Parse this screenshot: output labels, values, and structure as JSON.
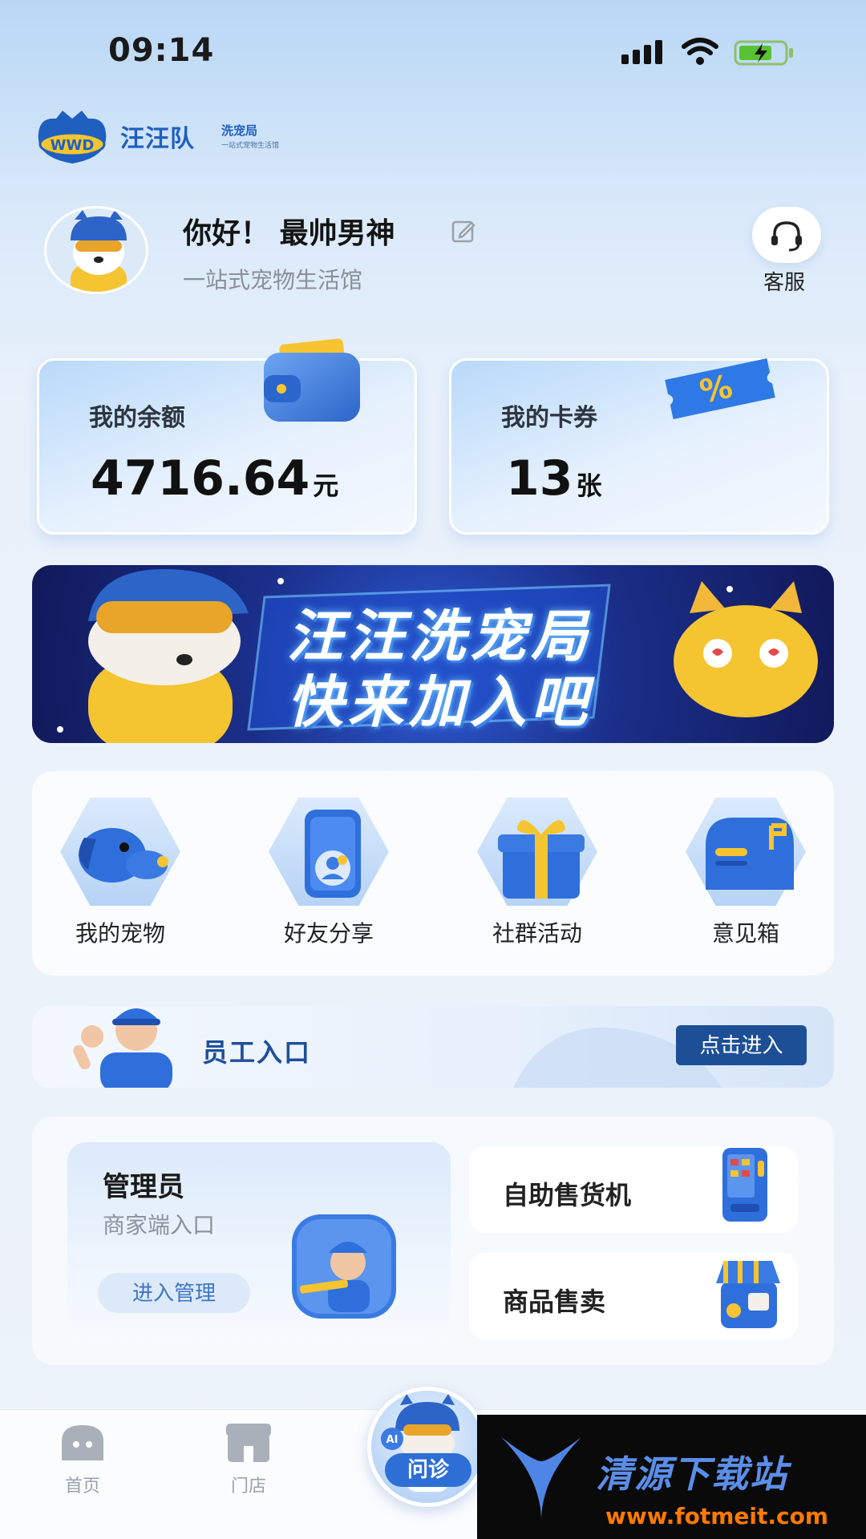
{
  "status_bar": {
    "time": "09:14"
  },
  "brand": {
    "name": "汪汪队",
    "suffix": "洗宠局",
    "tagline": "一站式宠物生活馆"
  },
  "profile": {
    "greeting": "你好！ 最帅男神",
    "slogan": "一站式宠物生活馆"
  },
  "service": {
    "label": "客服"
  },
  "stats": {
    "balance": {
      "title": "我的余额",
      "value": "4716.64",
      "unit": "元"
    },
    "coupons": {
      "title": "我的卡券",
      "value": "13",
      "unit": "张"
    }
  },
  "banner": {
    "line1": "汪汪洗宠局",
    "line2": "快来加入吧"
  },
  "menu": [
    {
      "label": "我的宠物",
      "icon": "dog-icon"
    },
    {
      "label": "好友分享",
      "icon": "share-phone-icon"
    },
    {
      "label": "社群活动",
      "icon": "gift-icon"
    },
    {
      "label": "意见箱",
      "icon": "mailbox-icon"
    }
  ],
  "staff": {
    "title": "员工入口",
    "button": "点击进入"
  },
  "admin": {
    "title": "管理员",
    "subtitle": "商家端入口",
    "button": "进入管理"
  },
  "side_cards": {
    "vending": "自助售货机",
    "goods": "商品售卖"
  },
  "tabbar": {
    "home": "首页",
    "store": "门店",
    "consult": "问诊",
    "ai_badge": "AI"
  },
  "watermark": {
    "name": "清源下载站",
    "url": "www.fotmeit.com"
  },
  "colors": {
    "primary": "#1d4f97",
    "accent": "#2e6fd6",
    "brand_yellow": "#f5c431"
  }
}
